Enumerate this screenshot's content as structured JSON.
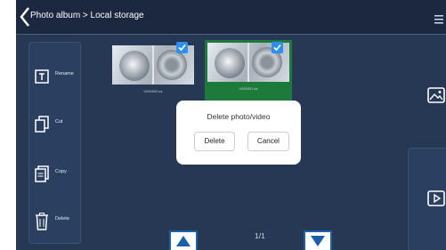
{
  "header": {
    "breadcrumb": "Photo album > Local storage"
  },
  "sidebar": {
    "items": [
      {
        "label": "Rename",
        "icon": "rename-icon"
      },
      {
        "label": "Cut",
        "icon": "cut-icon"
      },
      {
        "label": "Copy",
        "icon": "copy-icon"
      },
      {
        "label": "Delete",
        "icon": "trash-icon"
      }
    ]
  },
  "thumbnails": [
    {
      "caption": "V000002.ss",
      "selected": false,
      "checked": true
    },
    {
      "caption": "V000001.ss",
      "selected": true,
      "checked": true
    }
  ],
  "right_toolbar": {
    "photo_icon": "image-icon",
    "video_icon": "play-icon"
  },
  "pager": {
    "page_indicator": "1/1"
  },
  "dialog": {
    "title": "Delete photo/video",
    "delete_label": "Delete",
    "cancel_label": "Cancel"
  },
  "colors": {
    "accent": "#2f8ff0",
    "selected": "#1e7a3a",
    "background": "#263854"
  }
}
